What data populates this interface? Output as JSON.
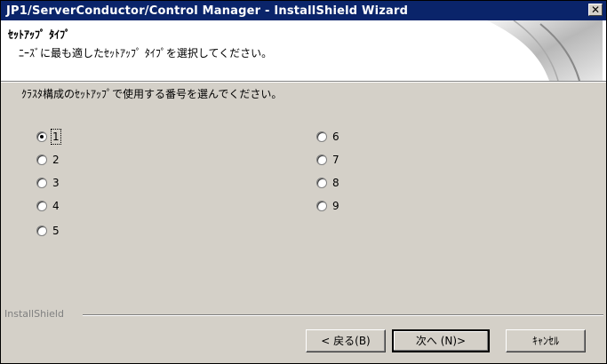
{
  "window": {
    "title": "JP1/ServerConductor/Control Manager - InstallShield Wizard",
    "close_glyph": "✕"
  },
  "header": {
    "title": "ｾｯﾄｱｯﾌﾟ ﾀｲﾌﾟ",
    "subtitle": "ﾆｰｽﾞに最も適したｾｯﾄｱｯﾌﾟ ﾀｲﾌﾟを選択してください。"
  },
  "prompt": "ｸﾗｽﾀ構成のｾｯﾄｱｯﾌﾟで使用する番号を選んでください。",
  "options_left": [
    {
      "label": "1",
      "checked": true
    },
    {
      "label": "2",
      "checked": false
    },
    {
      "label": "3",
      "checked": false
    },
    {
      "label": "4",
      "checked": false
    },
    {
      "label": "5",
      "checked": false
    }
  ],
  "options_right": [
    {
      "label": "6",
      "checked": false
    },
    {
      "label": "7",
      "checked": false
    },
    {
      "label": "8",
      "checked": false
    },
    {
      "label": "9",
      "checked": false
    }
  ],
  "footer": {
    "brand": "InstallShield",
    "back_label": "< 戻る(B)",
    "next_label": "次へ (N)>",
    "cancel_label": "ｷｬﾝｾﾙ"
  },
  "colors": {
    "titlebar": "#0a246a",
    "dialog_bg": "#d4d0c8",
    "header_bg": "#ffffff"
  }
}
